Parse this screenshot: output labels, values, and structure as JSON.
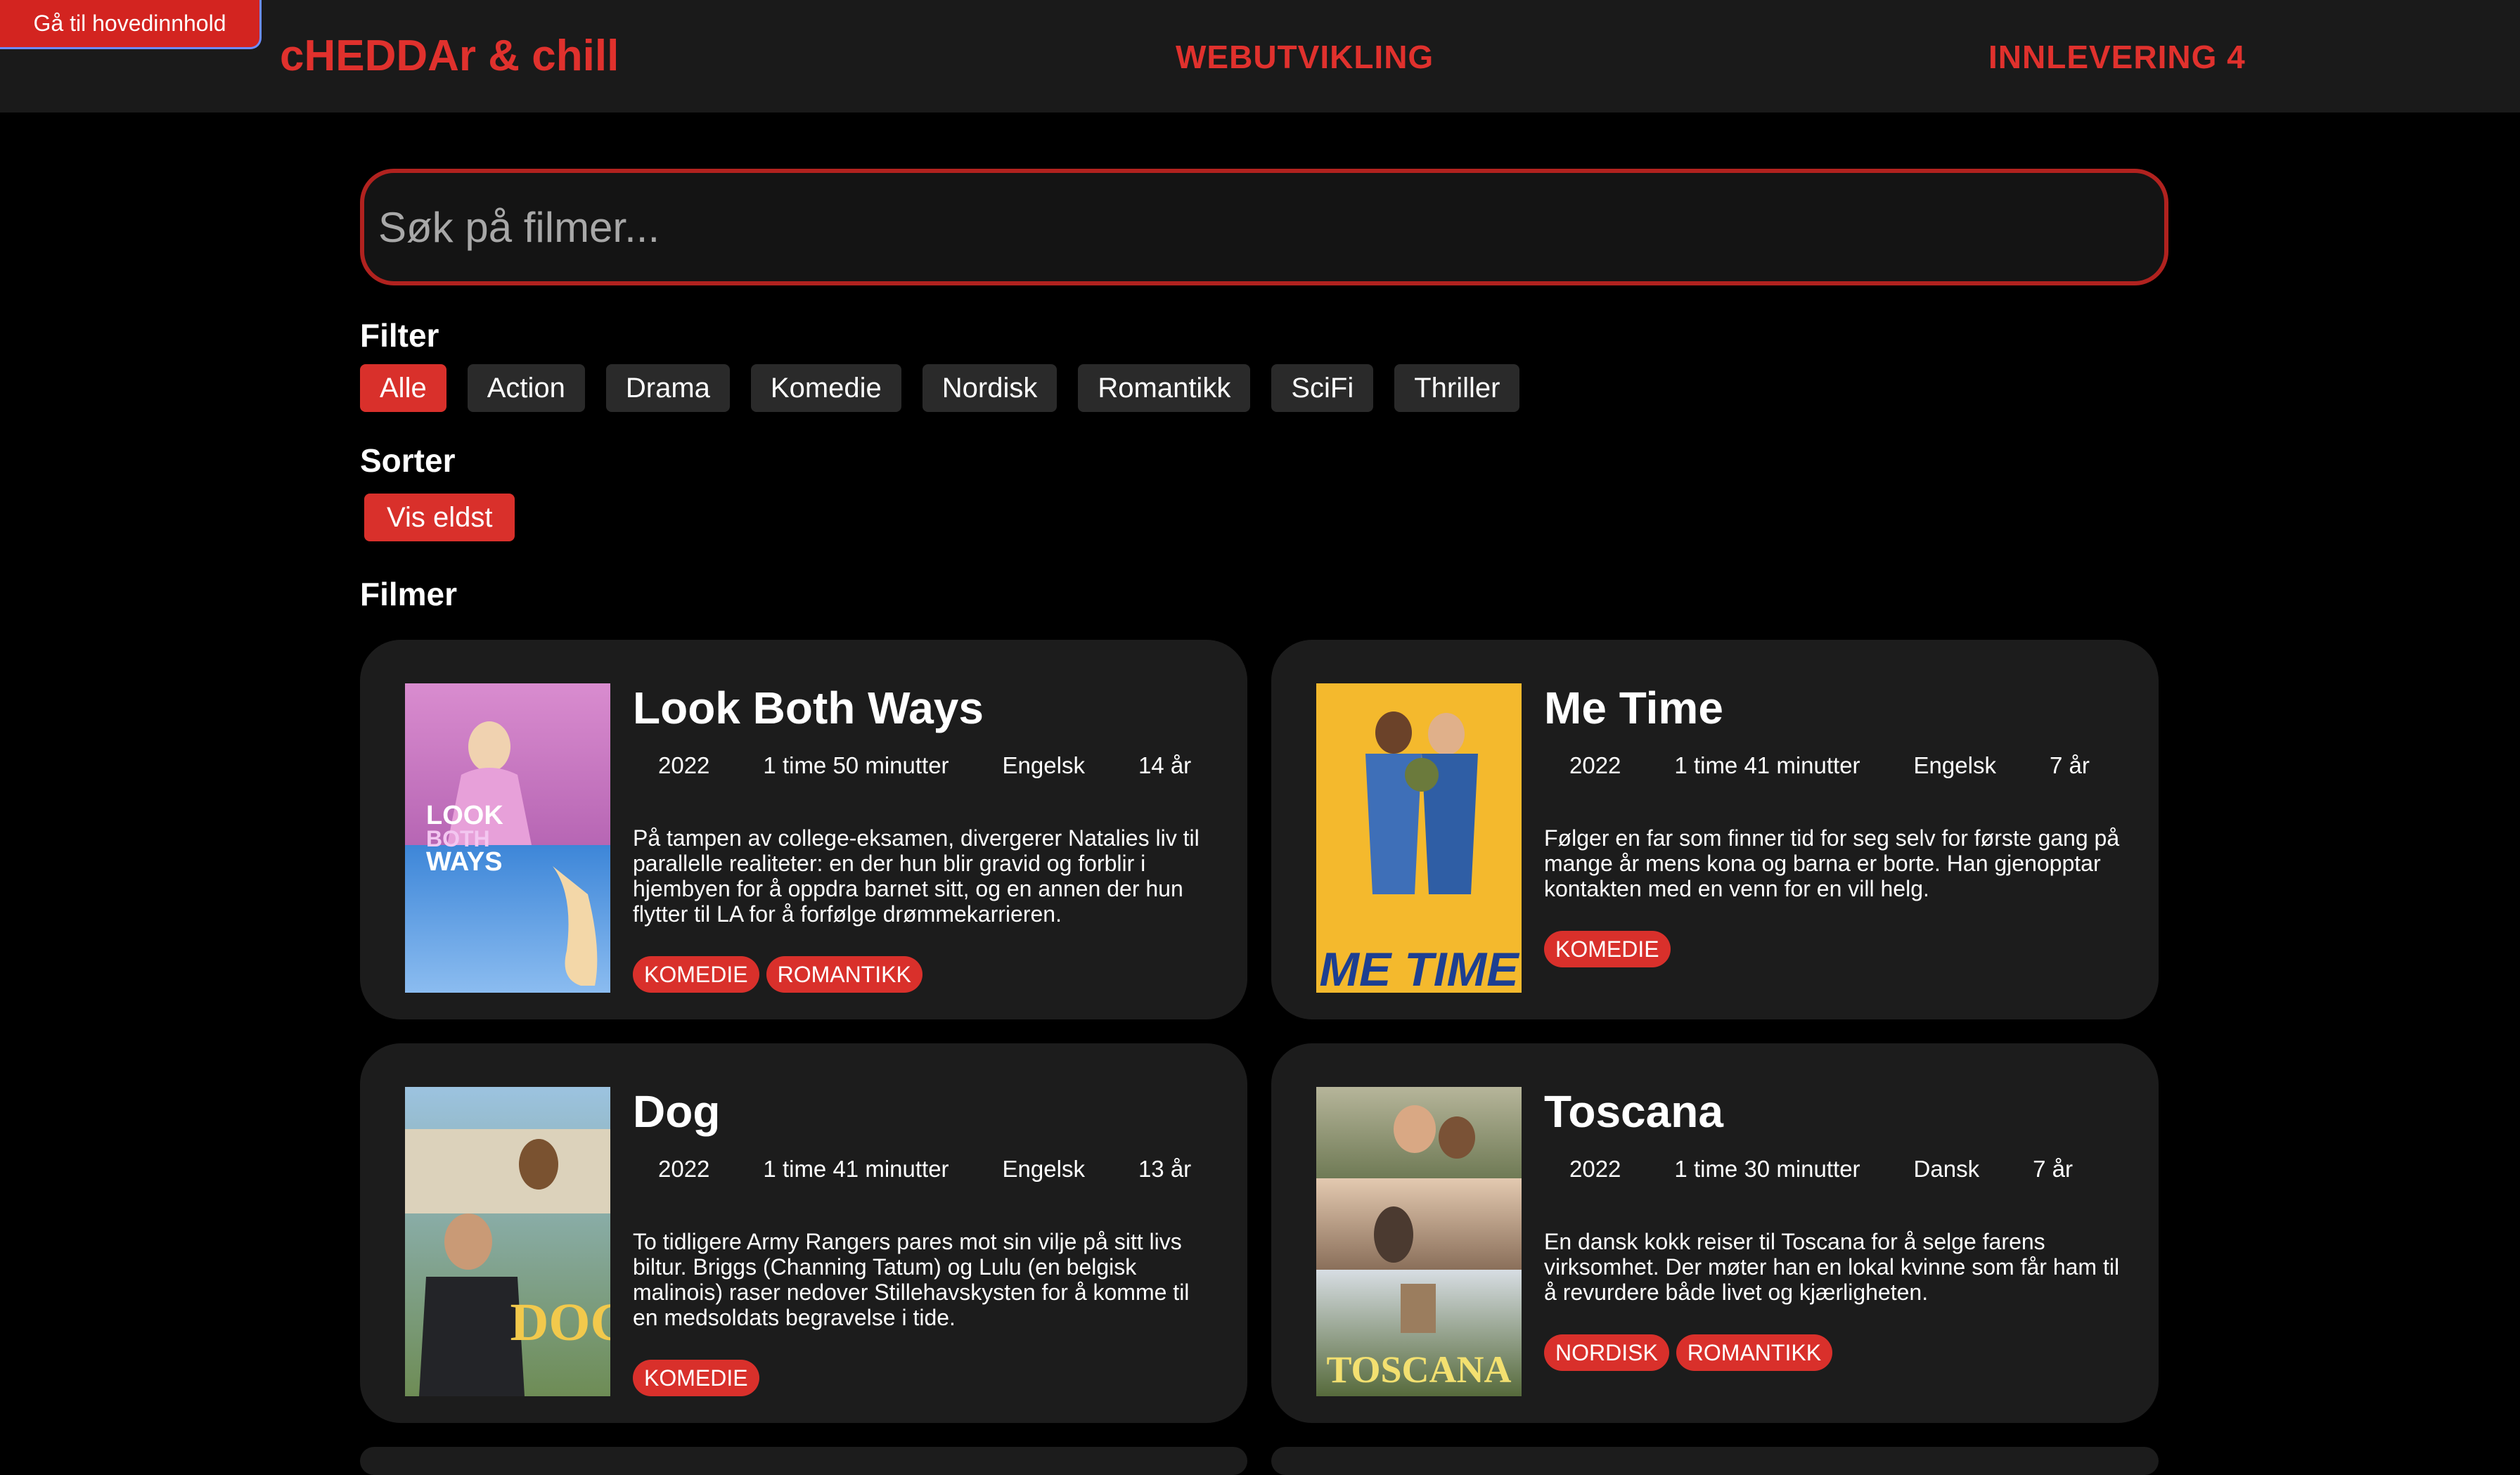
{
  "header": {
    "skip_link": "Gå til hovedinnhold",
    "brand": "cHEDDAr & chill",
    "nav": [
      "WEBUTVIKLING",
      "INNLEVERING 4"
    ]
  },
  "search": {
    "placeholder": "Søk på filmer..."
  },
  "filter": {
    "title": "Filter",
    "options": [
      "Alle",
      "Action",
      "Drama",
      "Komedie",
      "Nordisk",
      "Romantikk",
      "SciFi",
      "Thriller"
    ],
    "active": "Alle"
  },
  "sort": {
    "title": "Sorter",
    "button": "Vis eldst"
  },
  "movies_title": "Filmer",
  "movies": [
    {
      "title": "Look Both Ways",
      "year": "2022",
      "duration": "1 time 50 minutter",
      "language": "Engelsk",
      "age": "14 år",
      "description": "På tampen av college-eksamen, divergerer Natalies liv til parallelle realiteter: en der hun blir gravid og forblir i hjembyen for å oppdra barnet sitt, og en annen der hun flytter til LA for å forfølge drømmekarrieren.",
      "tags": [
        "KOMEDIE",
        "ROMANTIKK"
      ],
      "poster_text": "LOOK BOTH WAYS"
    },
    {
      "title": "Me Time",
      "year": "2022",
      "duration": "1 time 41 minutter",
      "language": "Engelsk",
      "age": "7 år",
      "description": "Følger en far som finner tid for seg selv for første gang på mange år mens kona og barna er borte. Han gjenopptar kontakten med en venn for en vill helg.",
      "tags": [
        "KOMEDIE"
      ],
      "poster_text": "ME TIME"
    },
    {
      "title": "Dog",
      "year": "2022",
      "duration": "1 time 41 minutter",
      "language": "Engelsk",
      "age": "13 år",
      "description": "To tidligere Army Rangers pares mot sin vilje på sitt livs biltur. Briggs (Channing Tatum) og Lulu (en belgisk malinois) raser nedover Stillehavskysten for å komme til en medsoldats begravelse i tide.",
      "tags": [
        "KOMEDIE"
      ],
      "poster_text": "DOG"
    },
    {
      "title": "Toscana",
      "year": "2022",
      "duration": "1 time 30 minutter",
      "language": "Dansk",
      "age": "7 år",
      "description": "En dansk kokk reiser til Toscana for å selge farens virksomhet. Der møter han en lokal kvinne som får ham til å revurdere både livet og kjærligheten.",
      "tags": [
        "NORDISK",
        "ROMANTIKK"
      ],
      "poster_text": "TOSCANA"
    }
  ]
}
